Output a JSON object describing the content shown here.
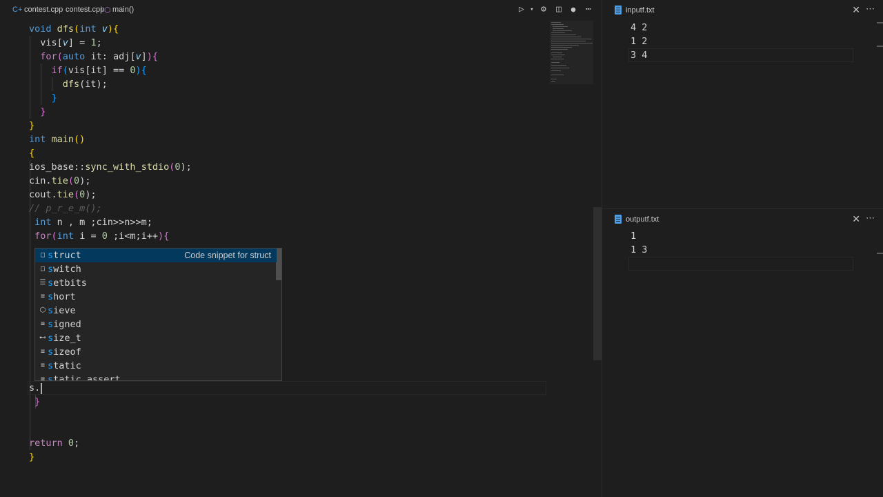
{
  "breadcrumb": {
    "file": "contest.cpp",
    "path_file": "contest.cpp",
    "symbol": "main()"
  },
  "editor_toolbar": {
    "run_icon": "run-debug-icon",
    "settings_icon": "gear-icon",
    "split_icon": "split-editor-icon",
    "dirty_icon": "unsaved-dot-icon",
    "more_icon": "more-actions-icon"
  },
  "code": {
    "l1": [
      "void",
      " ",
      "dfs",
      "(",
      "int",
      " ",
      "v",
      ")",
      "{"
    ],
    "l2": [
      "  vis[",
      "v",
      "] = ",
      "1",
      ";"
    ],
    "l3": [
      "  ",
      "for",
      "(",
      "auto",
      " it: adj[",
      "v",
      "]",
      ")",
      "{"
    ],
    "l4": [
      "    ",
      "if",
      "(",
      "vis[it] == ",
      "0",
      ")",
      "{"
    ],
    "l5": [
      "      ",
      "dfs",
      "(it);"
    ],
    "l6": [
      "    ",
      "}"
    ],
    "l7": [
      "  ",
      "}"
    ],
    "l8": [
      "}"
    ],
    "l9": [
      "int",
      " ",
      "main",
      "()"
    ],
    "l10": [
      "{"
    ],
    "l11": [
      "ios_base",
      "::",
      "sync_with_stdio",
      "(",
      "0",
      ");"
    ],
    "l12": [
      "cin.",
      "tie",
      "(",
      "0",
      ");"
    ],
    "l13": [
      "cout.",
      "tie",
      "(",
      "0",
      ");"
    ],
    "l14": [
      "// p_r_e_m();"
    ],
    "l15": [
      " ",
      "int",
      " n , m ;cin>>n>>m;"
    ],
    "l16": [
      " ",
      "for",
      "(",
      "int",
      " i = ",
      "0",
      " ;i<m;i++",
      ")",
      "{"
    ],
    "l17": [
      "s."
    ],
    "l18": [
      "}"
    ],
    "l19": [
      "return",
      " ",
      "0",
      ";"
    ],
    "l20": [
      "}"
    ]
  },
  "suggest": {
    "items": [
      {
        "prefix": "s",
        "rest": "truct",
        "icon": "snippet-icon",
        "detail": "Code snippet for struct"
      },
      {
        "prefix": "s",
        "rest": "witch",
        "icon": "snippet-icon",
        "detail": ""
      },
      {
        "prefix": "s",
        "rest": "etbits",
        "icon": "text-icon",
        "detail": ""
      },
      {
        "prefix": "s",
        "rest": "hort",
        "icon": "keyword-icon",
        "detail": ""
      },
      {
        "prefix": "s",
        "rest": "ieve",
        "icon": "method-icon",
        "detail": ""
      },
      {
        "prefix": "s",
        "rest": "igned",
        "icon": "keyword-icon",
        "detail": ""
      },
      {
        "prefix": "s",
        "rest": "ize_t",
        "icon": "typedef-icon",
        "detail": ""
      },
      {
        "prefix": "s",
        "rest": "izeof",
        "icon": "keyword-icon",
        "detail": ""
      },
      {
        "prefix": "s",
        "rest": "tatic",
        "icon": "keyword-icon",
        "detail": ""
      },
      {
        "prefix": "s",
        "rest": "tatic_assert",
        "icon": "keyword-icon",
        "detail": ""
      }
    ]
  },
  "input_pane": {
    "title": "inputf.txt",
    "lines": [
      "4 2",
      "1 2",
      "3 4"
    ]
  },
  "output_pane": {
    "title": "outputf.txt",
    "lines": [
      "1",
      "1 3"
    ]
  },
  "icons": {
    "close": "close-icon",
    "more": "more-actions-icon",
    "file": "file-icon"
  }
}
